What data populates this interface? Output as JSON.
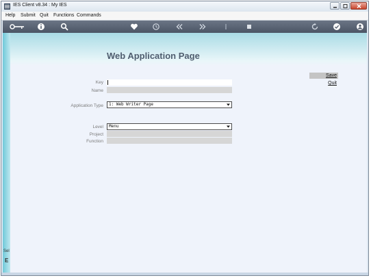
{
  "window": {
    "title": "IES Client v8.34 : My IES"
  },
  "menu": {
    "items": [
      "Help",
      "Submit",
      "Quit",
      "Functions",
      "Commands"
    ]
  },
  "toolbar": {
    "icons": [
      "key-icon",
      "info-icon",
      "search-icon",
      "heart-icon",
      "history-icon",
      "rewind-icon",
      "forward-icon",
      "pin-icon",
      "stop-icon",
      "refresh-icon",
      "check-icon",
      "user-icon"
    ]
  },
  "page": {
    "title": "Web Application Page",
    "save_label": "Save",
    "quit_label": "Quit",
    "fields": {
      "key": {
        "label": "Key",
        "value": ""
      },
      "name": {
        "label": "Name",
        "value": ""
      },
      "application_type": {
        "label": "Application Type",
        "value": "1: Web Writer Page"
      },
      "level": {
        "label": "Level",
        "value": "Menu"
      },
      "project": {
        "label": "Project",
        "value": ""
      },
      "function": {
        "label": "Function",
        "value": ""
      }
    }
  },
  "sidebar": {
    "fragment_text": "Sel",
    "fragment_letter": "E"
  }
}
